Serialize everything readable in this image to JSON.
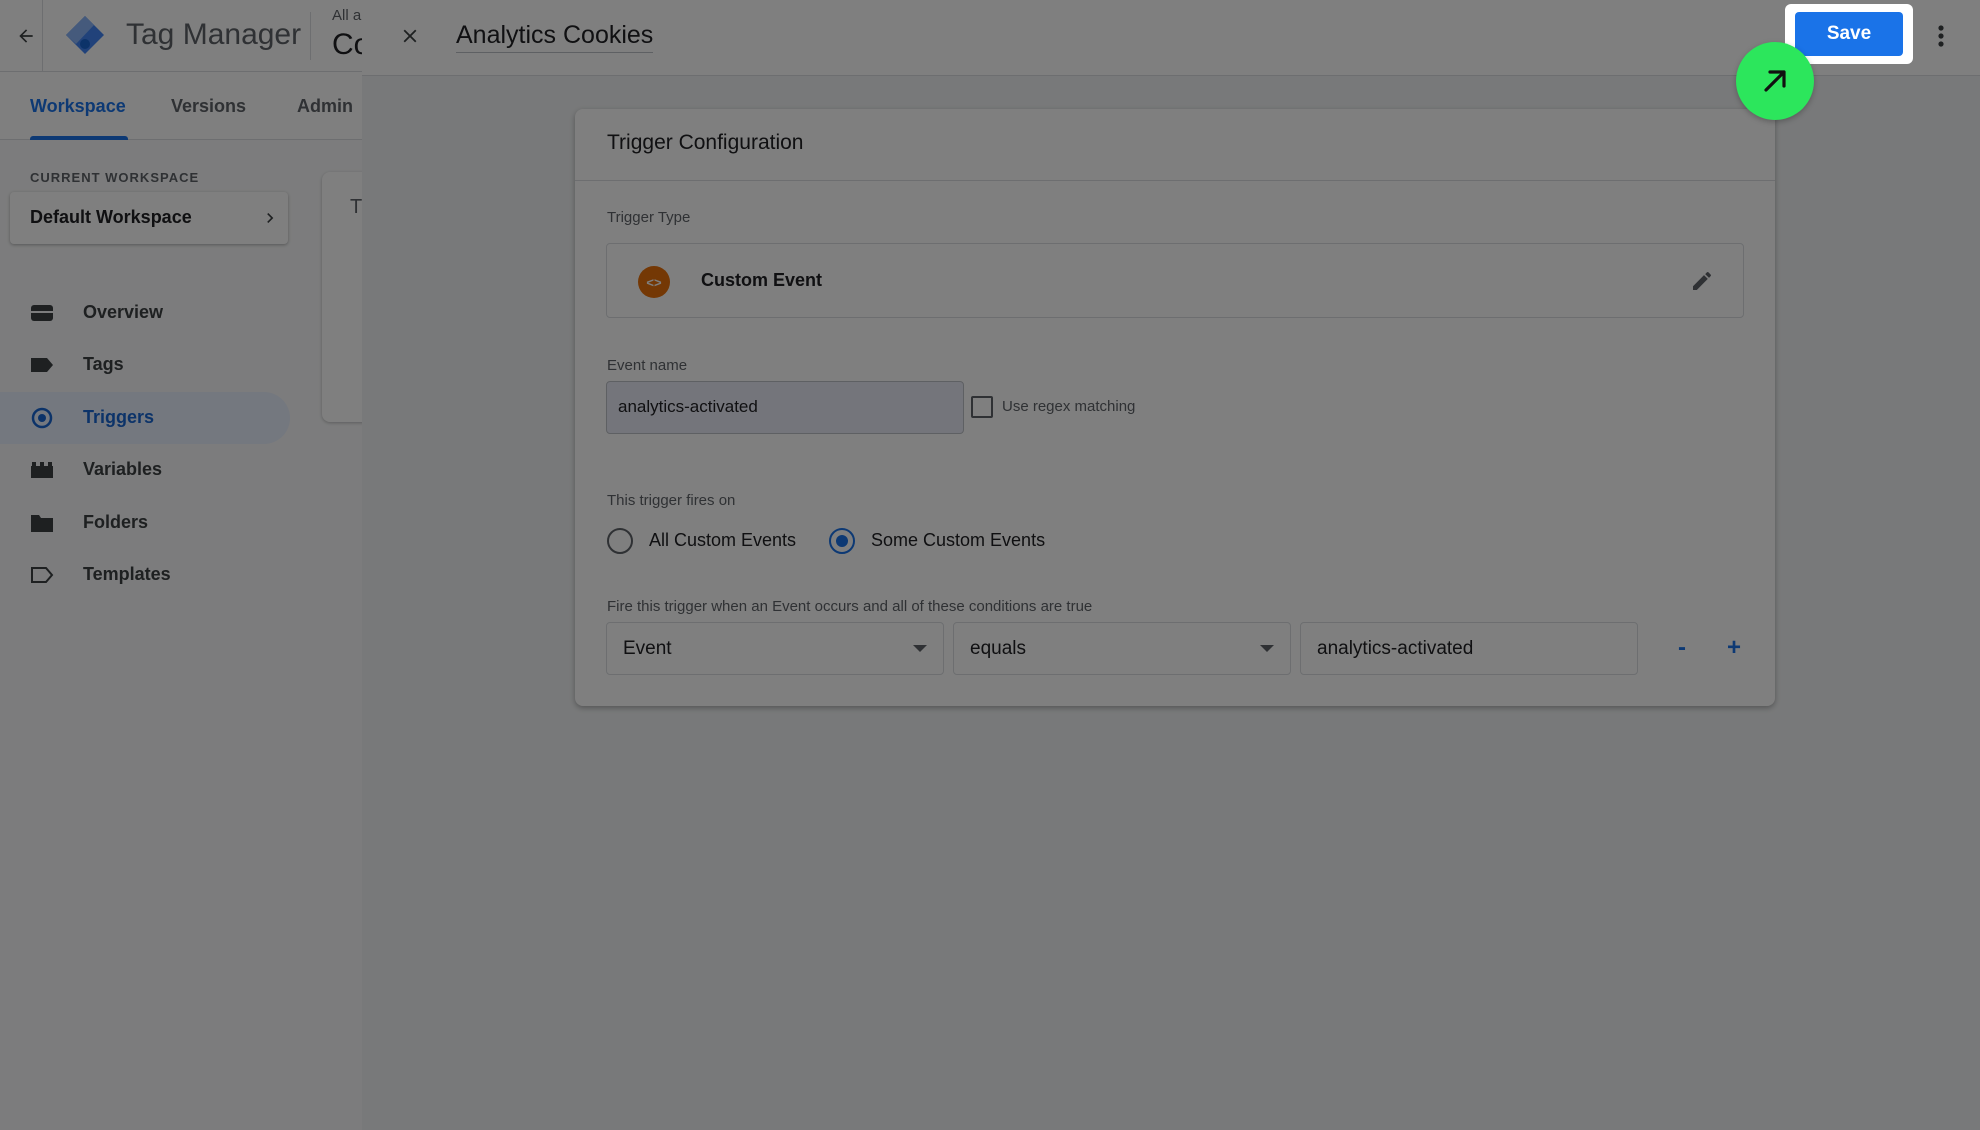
{
  "app": {
    "title": "Tag Manager",
    "account_small": "All a",
    "account_big": "Co",
    "tabs": [
      {
        "label": "Workspace",
        "active": true
      },
      {
        "label": "Versions",
        "active": false
      },
      {
        "label": "Admin",
        "active": false
      }
    ],
    "workspace_label": "CURRENT WORKSPACE",
    "workspace_name": "Default Workspace",
    "sidebar": [
      {
        "label": "Overview",
        "icon": "overview-icon"
      },
      {
        "label": "Tags",
        "icon": "tag-icon"
      },
      {
        "label": "Triggers",
        "icon": "trigger-icon",
        "active": true
      },
      {
        "label": "Variables",
        "icon": "variables-icon"
      },
      {
        "label": "Folders",
        "icon": "folder-icon"
      },
      {
        "label": "Templates",
        "icon": "template-icon"
      }
    ],
    "content_card_letter": "T"
  },
  "panel": {
    "title": "Analytics Cookies",
    "save_label": "Save",
    "config": {
      "title": "Trigger Configuration",
      "trigger_type_label": "Trigger Type",
      "trigger_type": "Custom Event",
      "event_name_label": "Event name",
      "event_name_value": "analytics-activated",
      "regex_label": "Use regex matching",
      "regex_checked": false,
      "fires_on_label": "This trigger fires on",
      "fires_on_options": [
        {
          "label": "All Custom Events",
          "checked": false
        },
        {
          "label": "Some Custom Events",
          "checked": true
        }
      ],
      "condition_label": "Fire this trigger when an Event occurs and all of these conditions are true",
      "condition": {
        "variable": "Event",
        "operator": "equals",
        "value": "analytics-activated"
      },
      "remove_label": "-",
      "add_label": "+"
    }
  },
  "colors": {
    "accent": "#1a73e8",
    "pointer": "#2ce65c",
    "trigger_type_icon": "#e8710a"
  }
}
